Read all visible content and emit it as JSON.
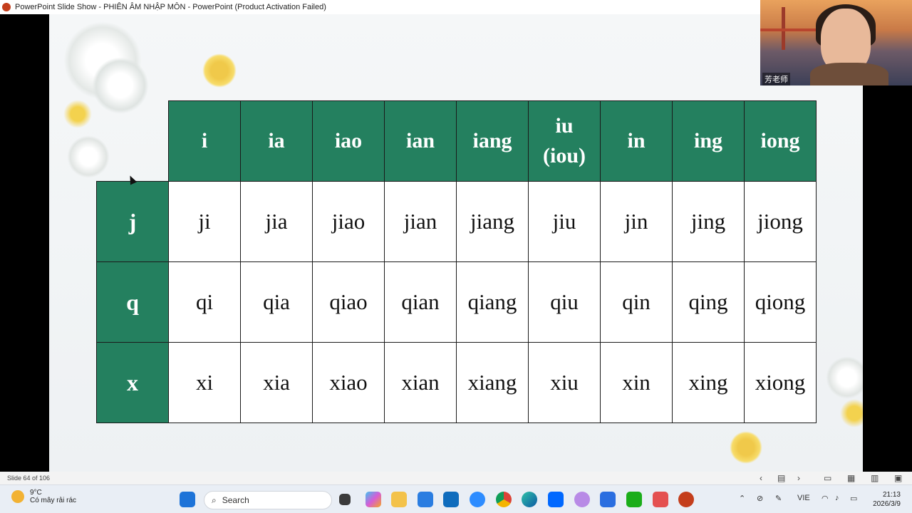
{
  "titlebar": {
    "title": "PowerPoint Slide Show  -  PHIÊN ÂM NHẬP MÔN - PowerPoint (Product Activation Failed)"
  },
  "table": {
    "columns": [
      "i",
      "ia",
      "iao",
      "ian",
      "iang",
      "iu",
      "in",
      "ing",
      "iong"
    ],
    "column_sub": {
      "iu": "(iou)"
    },
    "rows": [
      {
        "initial": "j",
        "cells": [
          "ji",
          "jia",
          "jiao",
          "jian",
          "jiang",
          "jiu",
          "jin",
          "jing",
          "jiong"
        ]
      },
      {
        "initial": "q",
        "cells": [
          "qi",
          "qia",
          "qiao",
          "qian",
          "qiang",
          "qiu",
          "qin",
          "qing",
          "qiong"
        ]
      },
      {
        "initial": "x",
        "cells": [
          "xi",
          "xia",
          "xiao",
          "xian",
          "xiang",
          "xiu",
          "xin",
          "xing",
          "xiong"
        ]
      }
    ],
    "colors": {
      "header": "#24805f",
      "cell": "#ffffff",
      "border": "#1a1a1a"
    }
  },
  "webcam": {
    "name": "芳老师"
  },
  "statusbar": {
    "slide_indicator": "Slide 64 of 106"
  },
  "taskbar": {
    "weather_temp": "9°C",
    "weather_desc": "Có mây rải rác",
    "search_placeholder": "Search",
    "language": "VIE",
    "time": "21:13",
    "date": "2026/3/9",
    "icons": [
      "windows-start-icon",
      "search-icon",
      "task-view-icon",
      "copilot-icon",
      "file-explorer-icon",
      "photos-icon",
      "outlook-icon",
      "zoom-icon",
      "chrome-icon",
      "edge-icon",
      "zalo-icon",
      "app-cat-icon",
      "snipping-icon",
      "wechat-icon",
      "clock-app-icon",
      "powerpoint-icon"
    ]
  }
}
